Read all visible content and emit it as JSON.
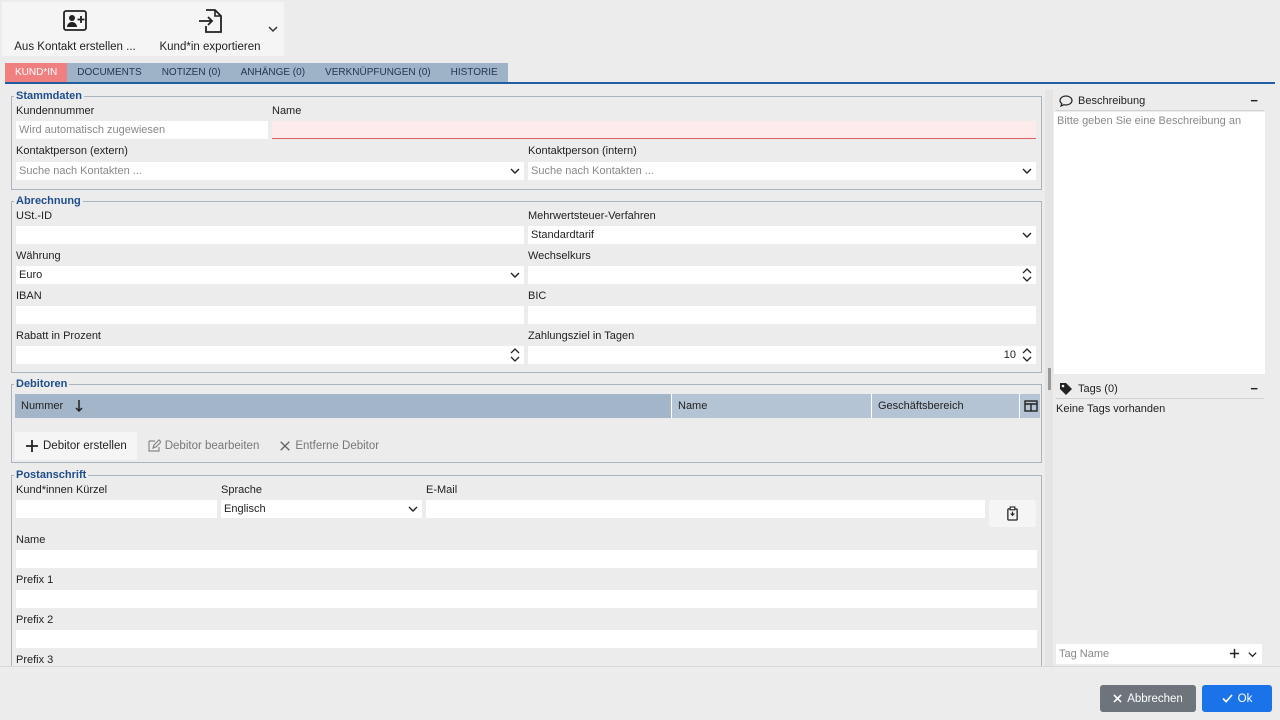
{
  "toolbar": {
    "create_from_contact": "Aus Kontakt erstellen ...",
    "export_customer": "Kund*in exportieren"
  },
  "tabs": [
    {
      "label": "KUND*IN"
    },
    {
      "label": "DOCUMENTS"
    },
    {
      "label": "NOTIZEN (0)"
    },
    {
      "label": "ANHÄNGE (0)"
    },
    {
      "label": "VERKNÜPFUNGEN (0)"
    },
    {
      "label": "HISTORIE"
    }
  ],
  "stammdaten": {
    "legend": "Stammdaten",
    "kundennummer_label": "Kundennummer",
    "kundennummer_placeholder": "Wird automatisch zugewiesen",
    "name_label": "Name",
    "name_value": "",
    "kontakt_extern_label": "Kontaktperson (extern)",
    "kontakt_extern_placeholder": "Suche nach Kontakten ...",
    "kontakt_intern_label": "Kontaktperson (intern)",
    "kontakt_intern_placeholder": "Suche nach Kontakten ..."
  },
  "abrechnung": {
    "legend": "Abrechnung",
    "ust_label": "USt.-ID",
    "ust_value": "",
    "mwst_label": "Mehrwertsteuer-Verfahren",
    "mwst_value": "Standardtarif",
    "waehrung_label": "Währung",
    "waehrung_value": "Euro",
    "wechselkurs_label": "Wechselkurs",
    "wechselkurs_value": "",
    "iban_label": "IBAN",
    "iban_value": "",
    "bic_label": "BIC",
    "bic_value": "",
    "rabatt_label": "Rabatt in Prozent",
    "rabatt_value": "",
    "zahlungsziel_label": "Zahlungsziel in Tagen",
    "zahlungsziel_value": "10"
  },
  "debitoren": {
    "legend": "Debitoren",
    "columns": [
      "Nummer",
      "Name",
      "Geschäftsbereich"
    ],
    "create_label": "Debitor erstellen",
    "edit_label": "Debitor bearbeiten",
    "remove_label": "Entferne Debitor"
  },
  "postanschrift": {
    "legend": "Postanschrift",
    "kuerzel_label": "Kund*innen Kürzel",
    "kuerzel_value": "",
    "sprache_label": "Sprache",
    "sprache_value": "Englisch",
    "email_label": "E-Mail",
    "email_value": "",
    "name_label": "Name",
    "prefix1_label": "Prefix 1",
    "prefix2_label": "Prefix 2",
    "prefix3_label": "Prefix 3"
  },
  "sidebar": {
    "description_title": "Beschreibung",
    "description_placeholder": "Bitte geben Sie eine Beschreibung an",
    "tags_title": "Tags (0)",
    "tags_empty": "Keine Tags vorhanden",
    "tag_input_placeholder": "Tag Name"
  },
  "footer": {
    "cancel_label": "Abbrechen",
    "ok_label": "Ok"
  },
  "colors": {
    "active_tab": "#f08080",
    "tab": "#9fb3c8",
    "legend": "#1f4e8c",
    "ok_button": "#1a73e8",
    "cancel_button": "#6d747b"
  }
}
